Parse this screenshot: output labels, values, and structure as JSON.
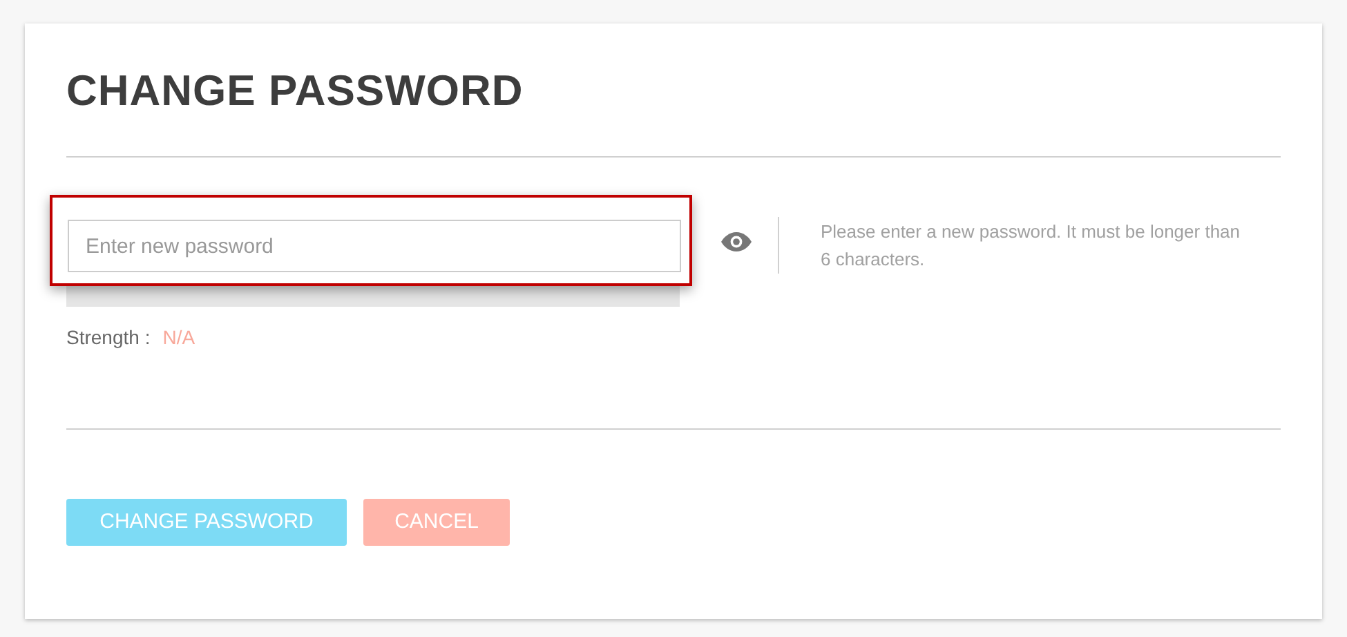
{
  "title": "CHANGE PASSWORD",
  "password_field": {
    "placeholder": "Enter new password",
    "highlighted": true
  },
  "strength_meter": {
    "level": 0
  },
  "help_text": "Please enter a new password. It must be longer than 6 characters.",
  "strength": {
    "label": "Strength :",
    "value": "N/A"
  },
  "buttons": [
    {
      "kind": "primary",
      "label": "CHANGE PASSWORD"
    },
    {
      "kind": "cancel",
      "label": "CANCEL"
    }
  ]
}
